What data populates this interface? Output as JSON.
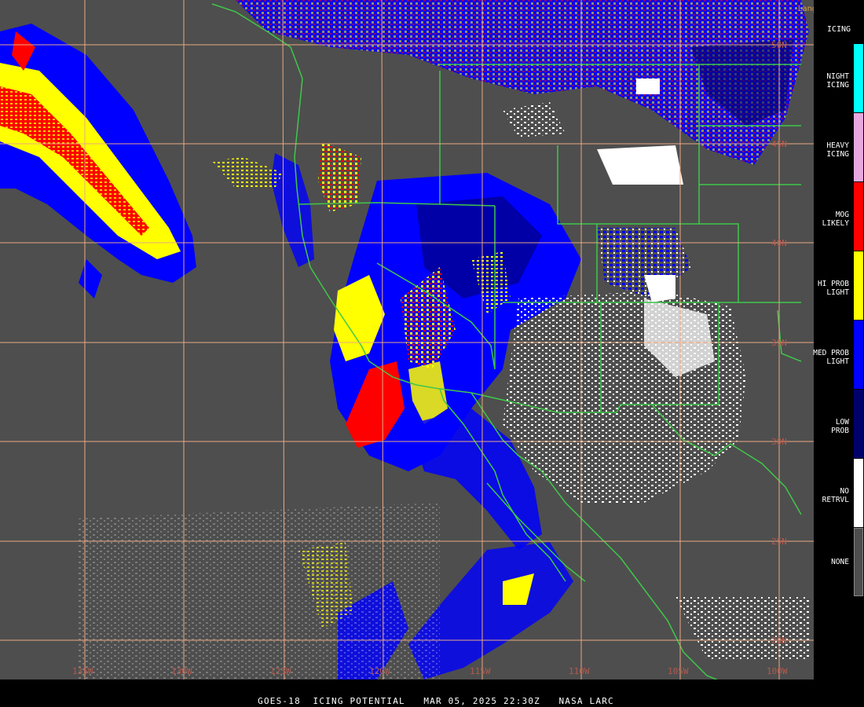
{
  "credit": "Langley (M04.0)",
  "caption": "GOES-18  ICING POTENTIAL   MAR 05, 2025 22:30Z   NASA LARC",
  "colors": {
    "background": "#4e4e4e",
    "grid": "#e8a882",
    "border": "#3fc74a",
    "night_icing": "#00ffff",
    "heavy_icing": "#e8a8e0",
    "mog_likely": "#ff0000",
    "hi_prob_light": "#ffff00",
    "med_prob_light": "#0000ff",
    "low_prob": "#00006b",
    "no_retrvl": "#ffffff",
    "none": "#4e4e4e"
  },
  "legend": {
    "title": "ICING",
    "items": [
      {
        "label": "NIGHT\nICING",
        "color": "#00ffff"
      },
      {
        "label": "HEAVY\nICING",
        "color": "#e8a8e0"
      },
      {
        "label": "MOG\nLIKELY",
        "color": "#ff0000"
      },
      {
        "label": "HI PROB\nLIGHT",
        "color": "#ffff00"
      },
      {
        "label": "MED PROB\nLIGHT",
        "color": "#0000ff"
      },
      {
        "label": "LOW\nPROB",
        "color": "#00006b"
      },
      {
        "label": "NO\nRETRVL",
        "color": "#ffffff"
      },
      {
        "label": "NONE",
        "color": "#4e4e4e"
      }
    ]
  },
  "grid": {
    "latitudes": [
      "50N",
      "45N",
      "40N",
      "35N",
      "30N",
      "25N",
      "20N"
    ],
    "longitudes": [
      "135W",
      "130W",
      "125W",
      "120W",
      "115W",
      "110W",
      "105W",
      "100W"
    ]
  }
}
